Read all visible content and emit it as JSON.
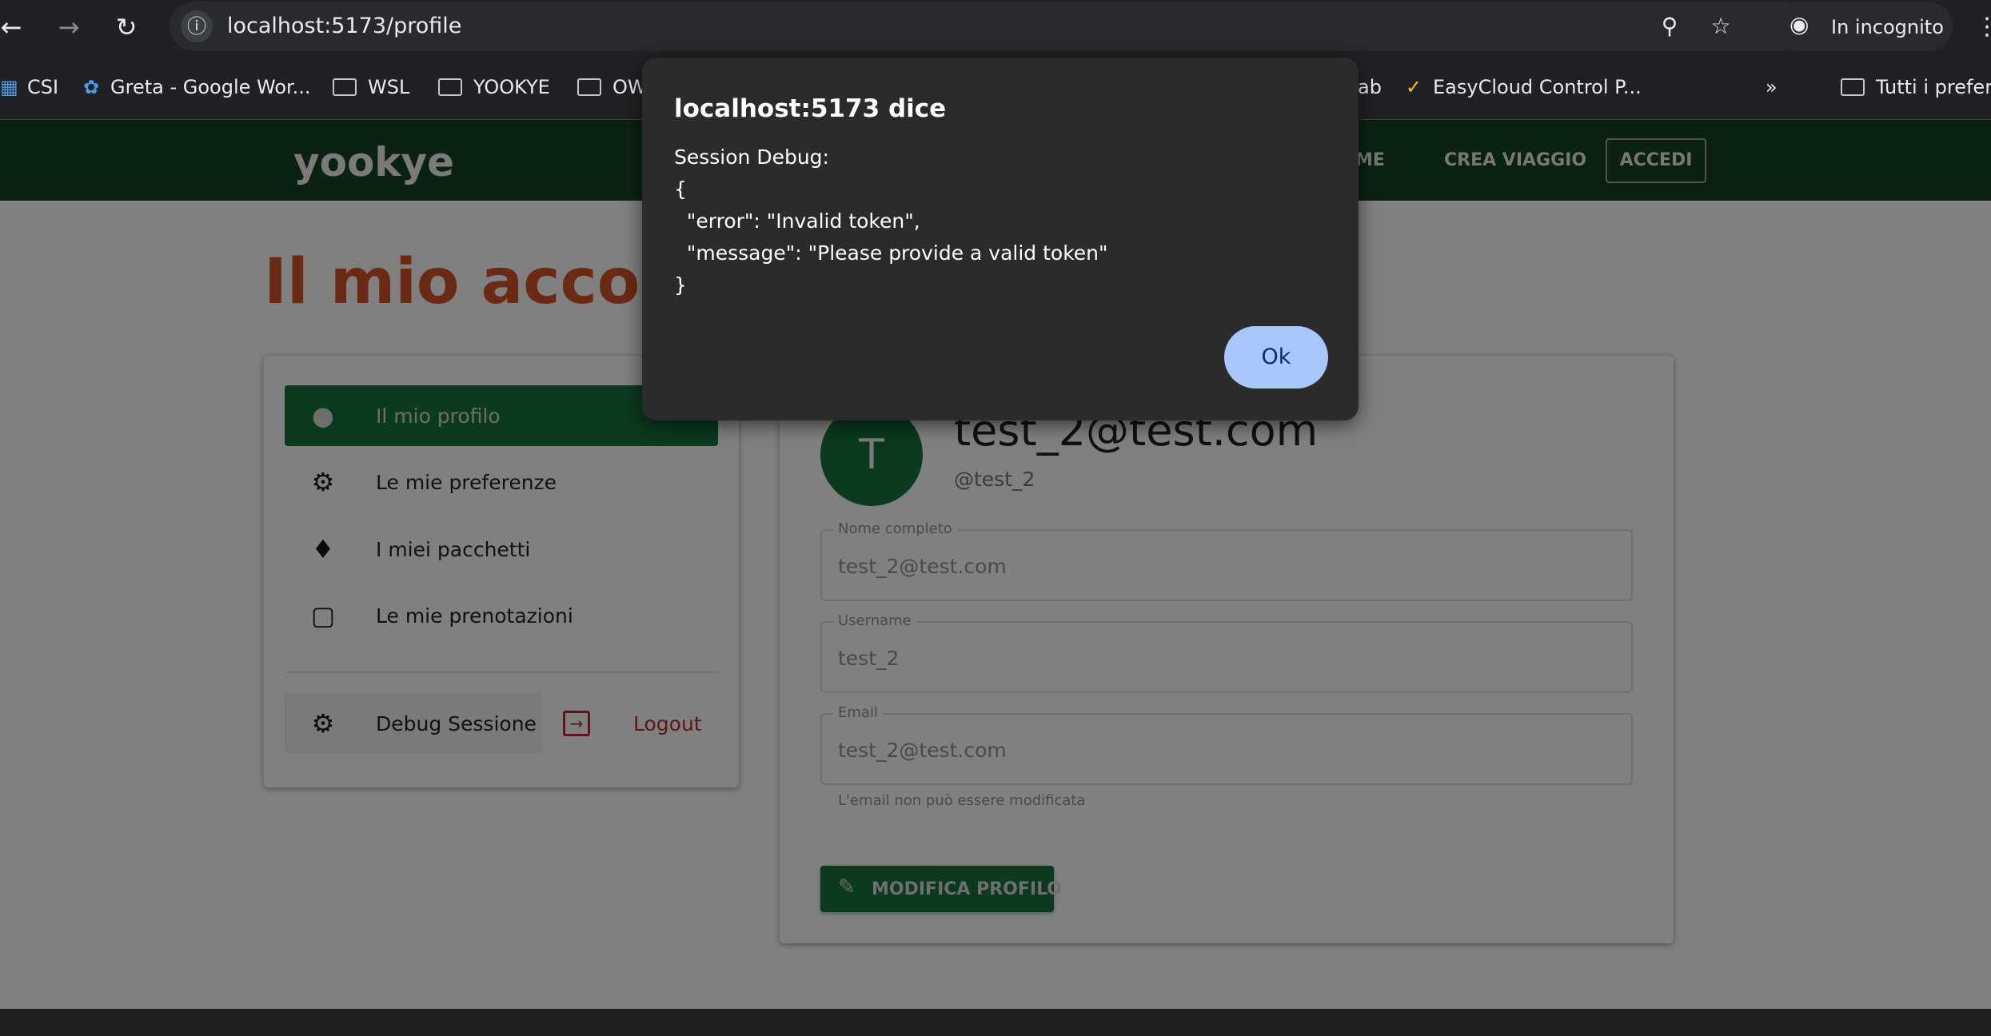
{
  "browser": {
    "url": "localhost:5173/profile",
    "incognito_label": "In incognito",
    "bookmarks": [
      {
        "label": "CSI"
      },
      {
        "label": "Greta - Google Wor..."
      },
      {
        "label": "WSL"
      },
      {
        "label": "YOOKYE"
      },
      {
        "label": "OW"
      },
      {
        "label": "ab"
      },
      {
        "label": "EasyCloud Control P..."
      },
      {
        "label": "Tutti i preferi"
      }
    ]
  },
  "app": {
    "brand": "yookye",
    "nav": {
      "home": "ME",
      "create_trip": "CREA VIAGGIO",
      "login": "ACCEDI"
    },
    "page_title": "Il mio accoun"
  },
  "sidebar": {
    "items": [
      {
        "label": "Il mio profilo",
        "icon": "person-icon"
      },
      {
        "label": "Le mie preferenze",
        "icon": "gear-icon"
      },
      {
        "label": "I miei pacchetti",
        "icon": "tag-icon"
      },
      {
        "label": "Le mie prenotazioni",
        "icon": "bookmark-icon"
      }
    ],
    "debug_label": "Debug Sessione",
    "logout_label": "Logout"
  },
  "profile": {
    "avatar_letter": "T",
    "email_title": "test_2@test.com",
    "handle": "@test_2",
    "fields": {
      "full_name": {
        "label": "Nome completo",
        "value": "test_2@test.com"
      },
      "username": {
        "label": "Username",
        "value": "test_2"
      },
      "email": {
        "label": "Email",
        "value": "test_2@test.com"
      }
    },
    "email_helper": "L'email non può essere modificata",
    "edit_button": "MODIFICA PROFILO"
  },
  "dialog": {
    "title": "localhost:5173 dice",
    "lines": [
      "Session Debug:",
      "{",
      "  \"error\": \"Invalid token\",",
      "  \"message\": \"Please provide a valid token\"",
      "}"
    ],
    "ok_label": "Ok"
  },
  "colors": {
    "app_bar": "#0b2212",
    "brand_green": "#0b3a1e",
    "title_accent": "#6b2a13",
    "logout_red": "#5c1616",
    "dialog_bg": "#2b2b2b",
    "ok_button": "#a8c7fa"
  }
}
